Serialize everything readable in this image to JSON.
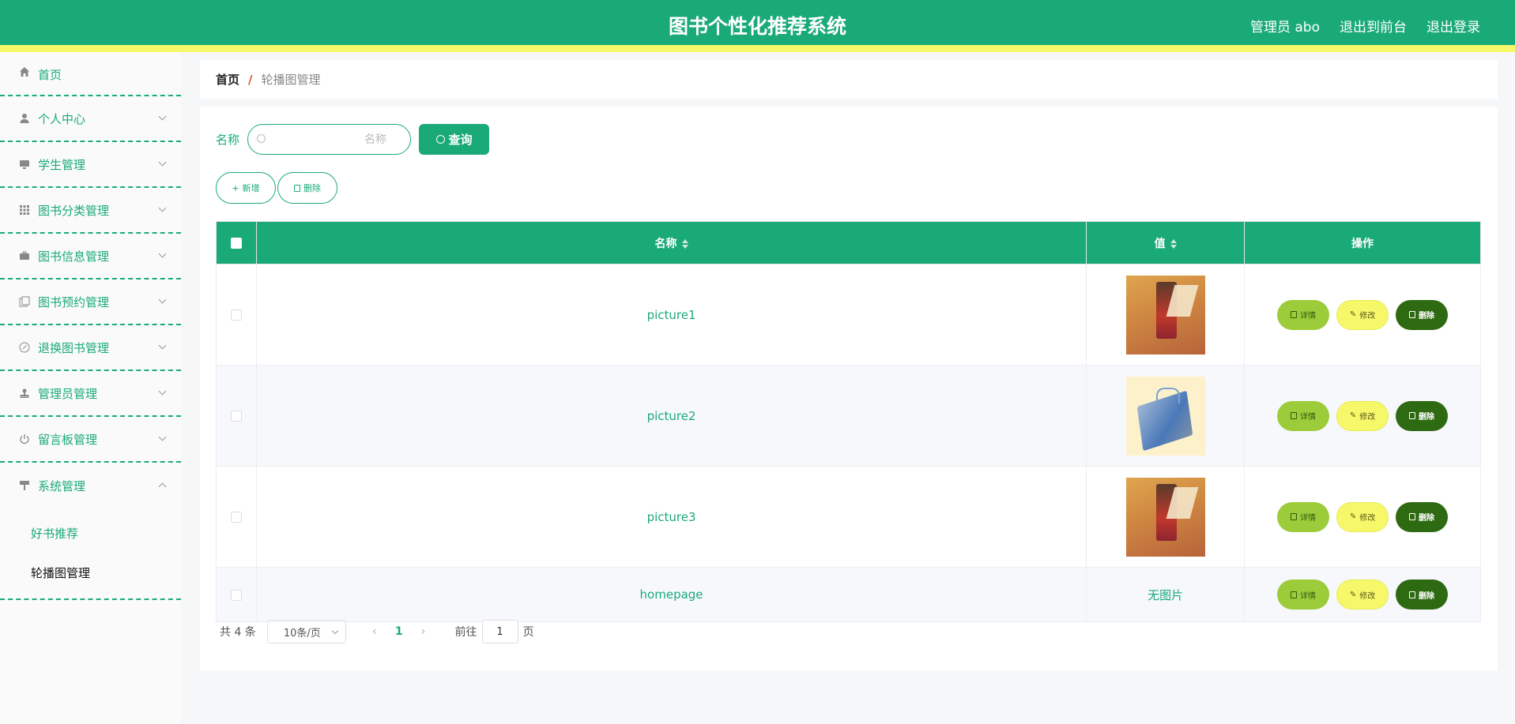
{
  "header": {
    "title": "图书个性化推荐系统",
    "user": "管理员 abo",
    "to_front": "退出到前台",
    "logout": "退出登录"
  },
  "sidebar": {
    "items": [
      {
        "label": "首页",
        "icon": "home-icon"
      },
      {
        "label": "个人中心",
        "icon": "user-icon"
      },
      {
        "label": "学生管理",
        "icon": "monitor-icon"
      },
      {
        "label": "图书分类管理",
        "icon": "grid-icon"
      },
      {
        "label": "图书信息管理",
        "icon": "briefcase-icon"
      },
      {
        "label": "图书预约管理",
        "icon": "copy-icon"
      },
      {
        "label": "退换图书管理",
        "icon": "compass-icon"
      },
      {
        "label": "管理员管理",
        "icon": "stamp-icon"
      },
      {
        "label": "留言板管理",
        "icon": "power-icon"
      },
      {
        "label": "系统管理",
        "icon": "brush-icon"
      }
    ],
    "sub_items": [
      "好书推荐",
      "轮播图管理"
    ]
  },
  "breadcrumb": {
    "home": "首页",
    "sep": "/",
    "current": "轮播图管理"
  },
  "search": {
    "label": "名称",
    "placeholder": "名称",
    "button": "查询"
  },
  "actions": {
    "add": "新增",
    "delete": "删除"
  },
  "table": {
    "headers": {
      "name": "名称",
      "value": "值",
      "ops": "操作"
    },
    "rows": [
      {
        "name": "picture1",
        "image": "book-photo-1"
      },
      {
        "name": "picture2",
        "image": "book-photo-2"
      },
      {
        "name": "picture3",
        "image": "book-photo-1"
      },
      {
        "name": "homepage",
        "value_text": "无图片"
      }
    ],
    "ops": {
      "detail": "详情",
      "edit": "修改",
      "delete": "删除"
    }
  },
  "pager": {
    "total": "共 4 条",
    "page_size": "10条/页",
    "current_page": "1",
    "goto": "前往",
    "goto_value": "1",
    "unit": "页"
  },
  "colors": {
    "primary": "#1aaa78",
    "accent_yellow": "#f7f76a",
    "lime": "#9ccc3a",
    "dark_green": "#2e6a12"
  }
}
